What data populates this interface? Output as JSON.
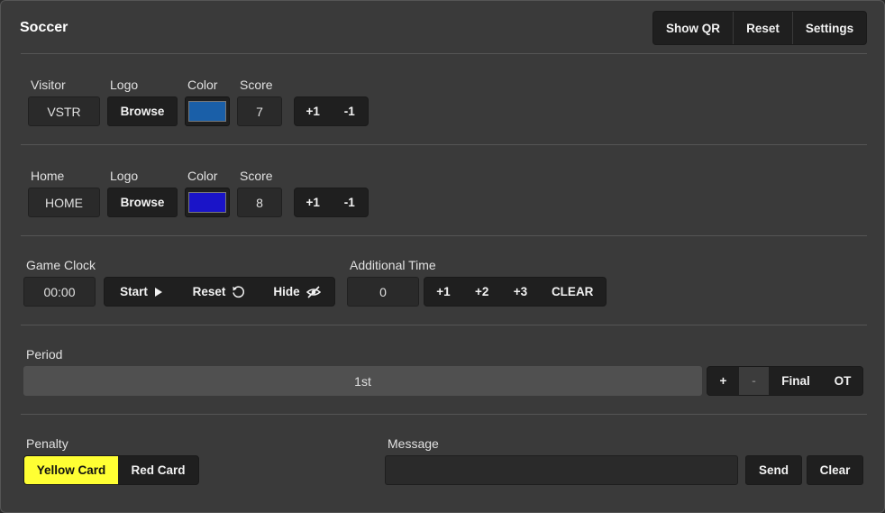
{
  "app": {
    "title": "Soccer"
  },
  "header": {
    "show_qr": "Show QR",
    "reset": "Reset",
    "settings": "Settings"
  },
  "visitor": {
    "team_label": "Visitor",
    "logo_label": "Logo",
    "color_label": "Color",
    "score_label": "Score",
    "name": "VSTR",
    "browse": "Browse",
    "color": "#1a5fa8",
    "score": "7",
    "plus": "+1",
    "minus": "-1"
  },
  "home": {
    "team_label": "Home",
    "logo_label": "Logo",
    "color_label": "Color",
    "score_label": "Score",
    "name": "HOME",
    "browse": "Browse",
    "color": "#1a14c8",
    "score": "8",
    "plus": "+1",
    "minus": "-1"
  },
  "clock": {
    "label": "Game Clock",
    "value": "00:00",
    "start": "Start",
    "reset": "Reset",
    "hide": "Hide",
    "icons": {
      "start": "play-icon",
      "reset": "restart-icon",
      "hide": "eye-slash-icon"
    }
  },
  "additional": {
    "label": "Additional Time",
    "value": "0",
    "plus1": "+1",
    "plus2": "+2",
    "plus3": "+3",
    "clear": "CLEAR"
  },
  "period": {
    "label": "Period",
    "value": "1st",
    "plus": "+",
    "minus": "-",
    "final": "Final",
    "ot": "OT"
  },
  "penalty": {
    "label": "Penalty",
    "yellow": "Yellow Card",
    "red": "Red Card",
    "active_color": "#ffff33"
  },
  "message": {
    "label": "Message",
    "value": "",
    "send": "Send",
    "clear": "Clear"
  }
}
